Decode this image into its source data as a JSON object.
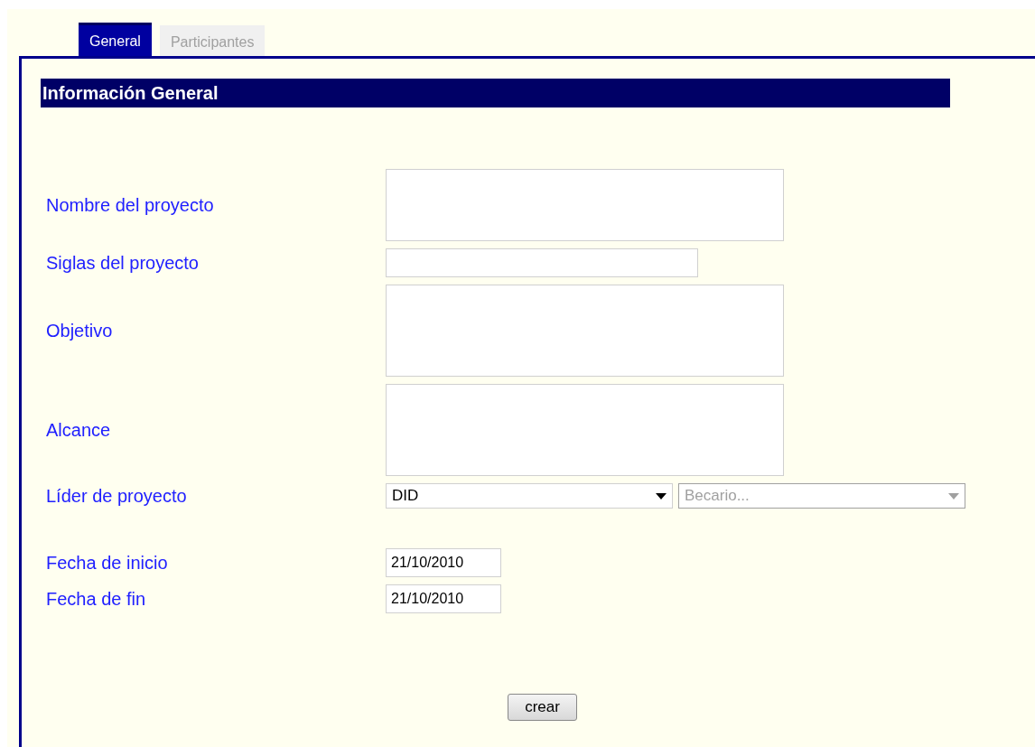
{
  "tabs": [
    {
      "label": "General",
      "selected": true
    },
    {
      "label": "Participantes",
      "selected": false
    }
  ],
  "section_title": "Información General",
  "fields": [
    {
      "label": "Nombre del proyecto",
      "kind": "textarea"
    },
    {
      "label": "Siglas del proyecto",
      "kind": "text"
    },
    {
      "label": "Objetivo",
      "kind": "memo"
    },
    {
      "label": "Alcance",
      "kind": "memo"
    },
    {
      "label": "Líder de proyecto",
      "kind": "selects",
      "selects": [
        {
          "value": "DID",
          "disabled": false
        },
        {
          "placeholder": "Becario...",
          "disabled": true
        }
      ]
    },
    {
      "label": "Fecha de inicio",
      "kind": "date",
      "value": "21/10/2010"
    },
    {
      "label": "Fecha de fin",
      "kind": "date",
      "value": "21/10/2010"
    }
  ],
  "submit": "crear"
}
